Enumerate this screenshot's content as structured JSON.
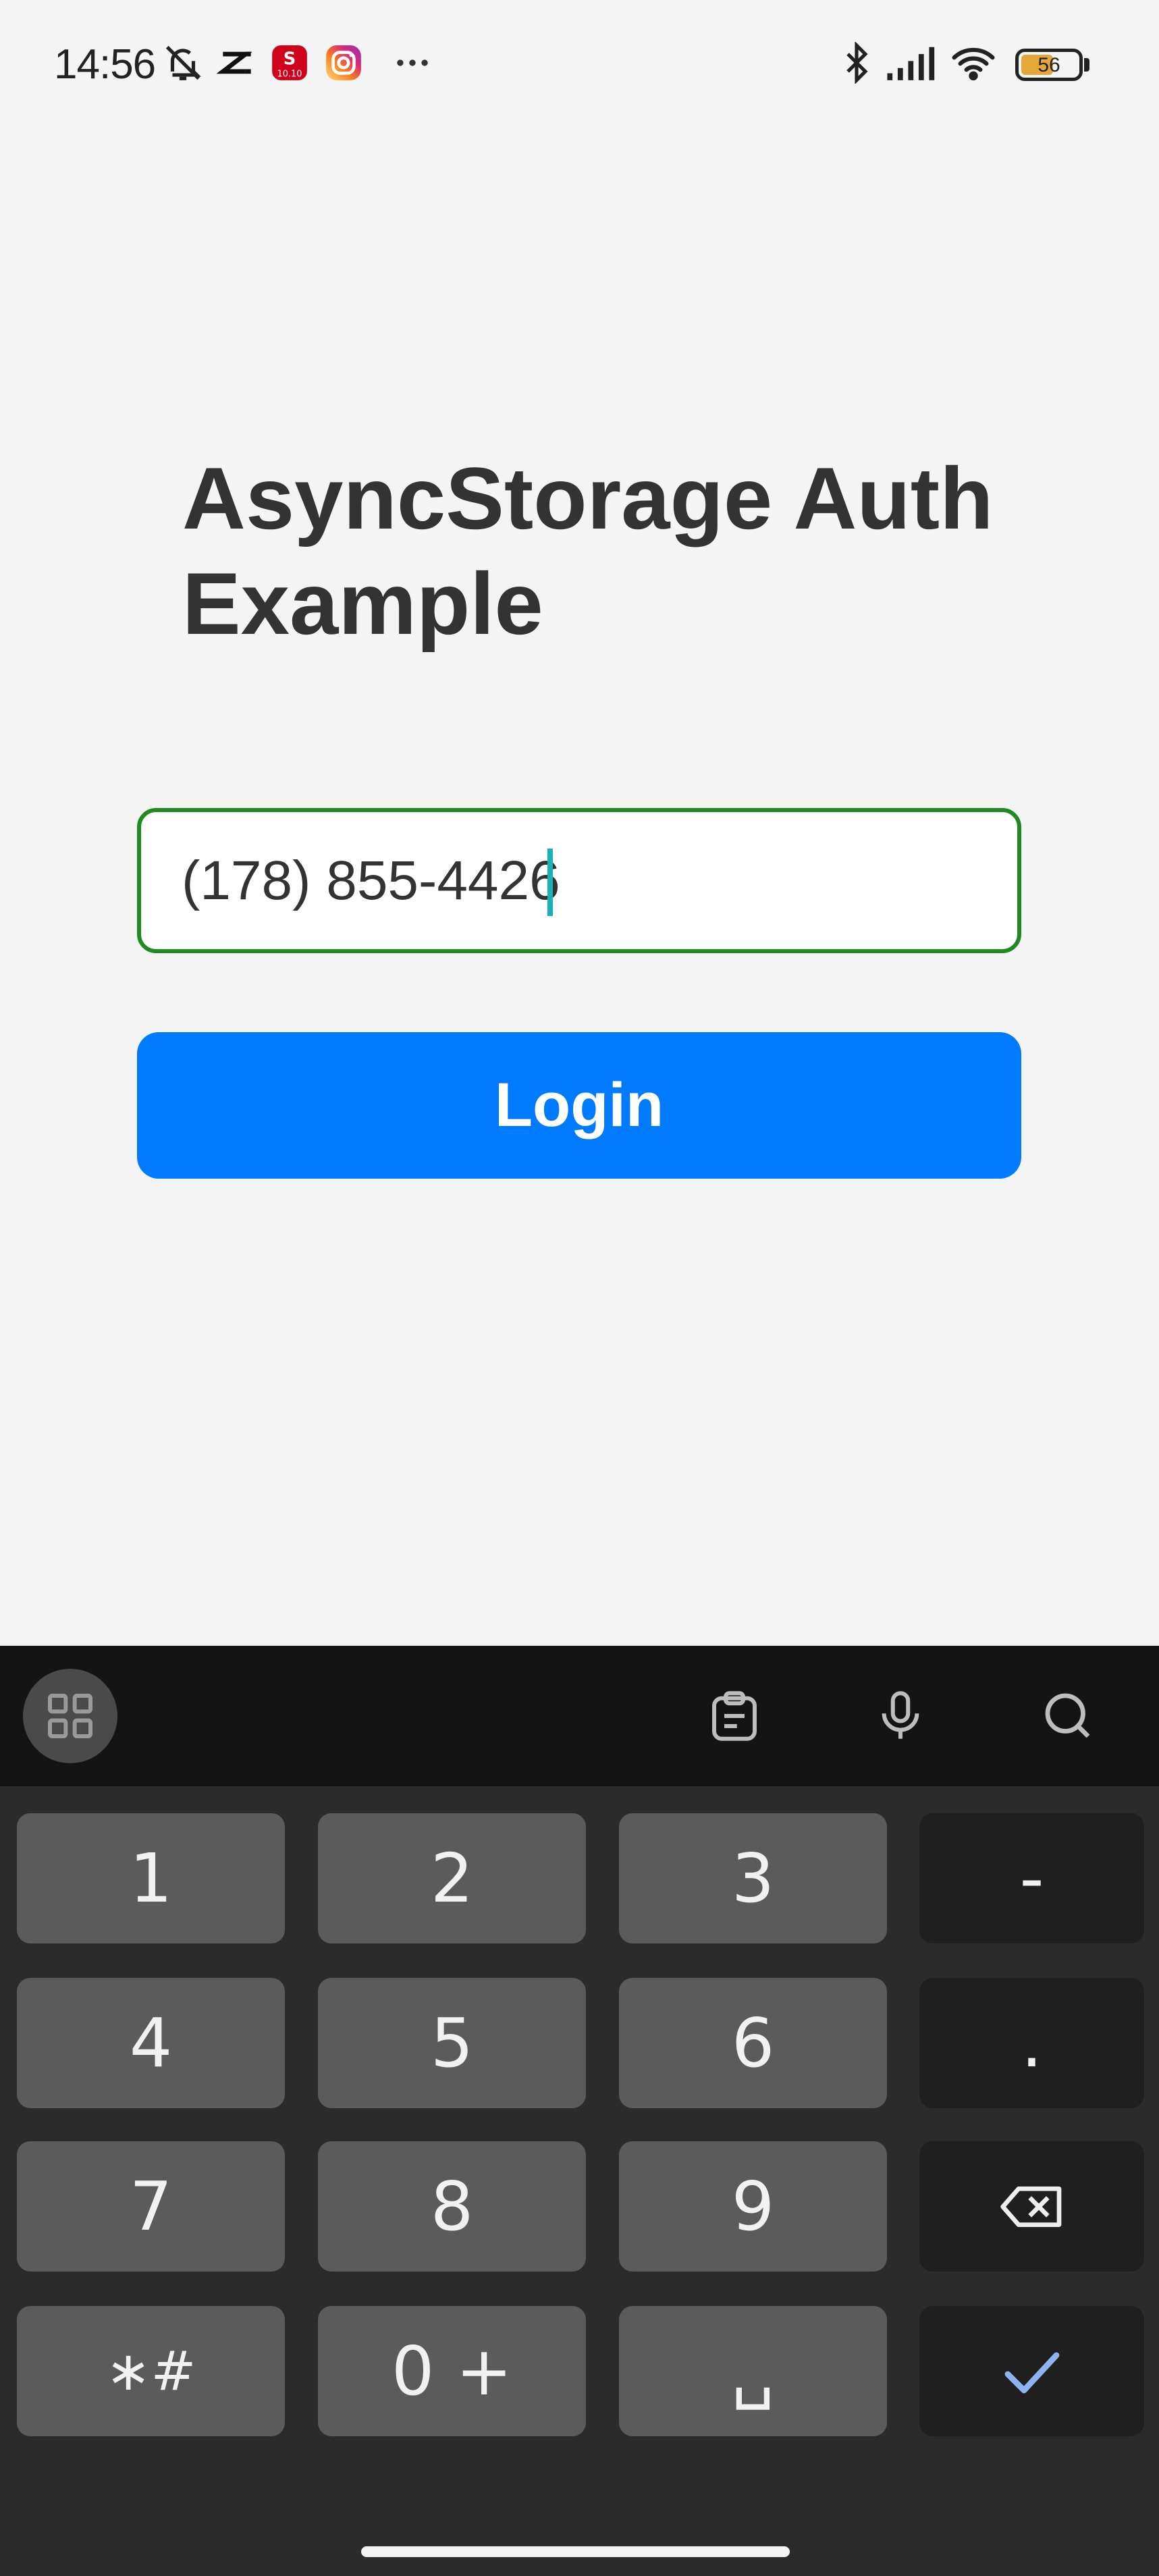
{
  "status_bar": {
    "time": "14:56",
    "icons": [
      "bell-off-icon",
      "capcut-icon",
      "shopee-icon",
      "instagram-icon",
      "more-icon",
      "bluetooth-icon",
      "signal-icon",
      "wifi-icon"
    ],
    "battery_level": "56"
  },
  "screen": {
    "title": "AsyncStorage Auth Example",
    "phone_input": {
      "value": "(178) 855-4426"
    },
    "login_button": "Login"
  },
  "keyboard": {
    "toolbar_icons": [
      "keyboard-menu-icon",
      "clipboard-icon",
      "microphone-icon",
      "search-icon"
    ],
    "keys": {
      "k1": "1",
      "k2": "2",
      "k3": "3",
      "dash": "-",
      "k4": "4",
      "k5": "5",
      "k6": "6",
      "dot": ".",
      "k7": "7",
      "k8": "8",
      "k9": "9",
      "symbols": "∗#",
      "zero": "0 +",
      "space": "␣"
    },
    "accent_color": "#8fb2f0"
  }
}
